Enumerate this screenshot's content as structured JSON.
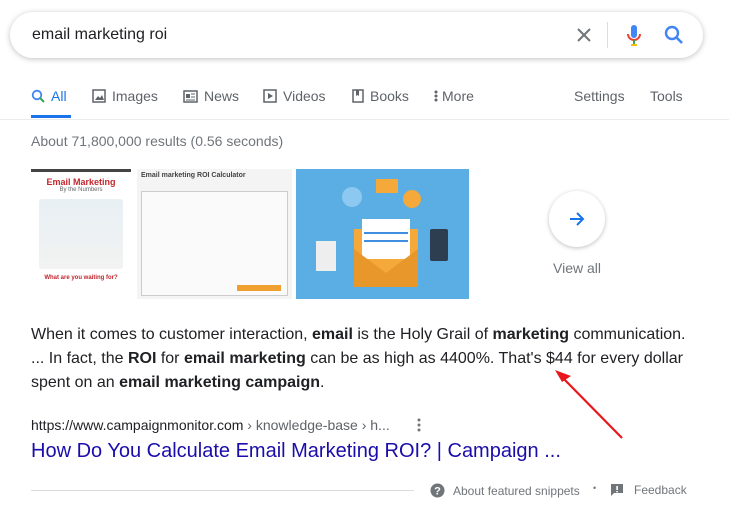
{
  "search": {
    "query": "email marketing roi",
    "clear_icon": "close-icon",
    "voice_icon": "mic-icon",
    "search_icon": "search-icon"
  },
  "tabs": [
    {
      "label": "All",
      "icon": "search-icon"
    },
    {
      "label": "Images",
      "icon": "image-icon"
    },
    {
      "label": "News",
      "icon": "news-icon"
    },
    {
      "label": "Videos",
      "icon": "play-icon"
    },
    {
      "label": "Books",
      "icon": "book-icon"
    },
    {
      "label": "More",
      "icon": "more-vert-icon"
    }
  ],
  "tools": {
    "settings": "Settings",
    "tools": "Tools"
  },
  "result_stats": "About 71,800,000 results (0.56 seconds)",
  "images": {
    "img1_title": "Email Marketing",
    "img1_sub": "By the Numbers",
    "img1_footer": "What are you waiting for?",
    "img2_title": "Email marketing ROI Calculator",
    "view_all": "View all"
  },
  "snippet": {
    "parts": [
      "When it comes to customer interaction, ",
      "email",
      " is the Holy Grail of ",
      "marketing",
      " communication. ... In fact, the ",
      "ROI",
      " for ",
      "email marketing",
      " can be as high as 4400%. That's $44 for every dollar spent on an ",
      "email marketing campaign",
      "."
    ]
  },
  "result": {
    "url": "https://www.campaignmonitor.com",
    "crumbs": " › knowledge-base › h...",
    "title": "How Do You Calculate Email Marketing ROI? | Campaign ..."
  },
  "footer": {
    "about": "About featured snippets",
    "separator": "•",
    "feedback": "Feedback"
  },
  "colors": {
    "accent": "#1a73e8",
    "link": "#1a0dab",
    "annotation_arrow": "#e8171b"
  }
}
